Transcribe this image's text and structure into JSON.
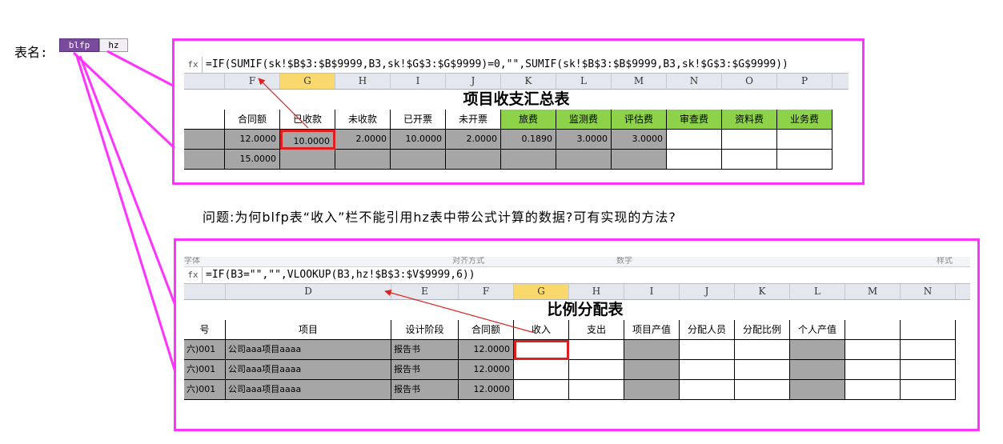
{
  "label_prefix": "表名:",
  "tabs": [
    "blfp",
    "hz"
  ],
  "question": "问题:为何blfp表“收入”栏不能引用hz表中带公式计算的数据?可有实现的方法?",
  "colors": {
    "frame": "#ff33ff",
    "arrow": "#e02020",
    "gray": "#a6a6a6",
    "green": "#8ed24a"
  },
  "top": {
    "formula": "=IF(SUMIF(sk!$B$3:$B$9999,B3,sk!$G$3:$G$9999)=0,\"\",SUMIF(sk!$B$3:$B$9999,B3,sk!$G$3:$G$9999))",
    "columns": [
      "F",
      "G",
      "H",
      "I",
      "J",
      "K",
      "L",
      "M",
      "N",
      "O",
      "P"
    ],
    "selected_column": "G",
    "title": "项目收支汇总表",
    "headers": [
      "合同额",
      "已收款",
      "未收款",
      "已开票",
      "未开票",
      "旅费",
      "监测费",
      "评估费",
      "审查费",
      "资料费",
      "业务费"
    ],
    "row1": [
      "12.0000",
      "10.0000",
      "2.0000",
      "10.0000",
      "2.0000",
      "0.1890",
      "3.0000",
      "3.0000",
      "",
      "",
      ""
    ],
    "row2": [
      "15.0000",
      "",
      "",
      "",
      "",
      "",
      "",
      "",
      "",
      "",
      ""
    ]
  },
  "bottom": {
    "ribbon": [
      "字体",
      "对齐方式",
      "数字",
      "样式"
    ],
    "formula": "=IF(B3=\"\",\"\",VLOOKUP(B3,hz!$B$3:$V$9999,6))",
    "columns": [
      "D",
      "E",
      "F",
      "G",
      "H",
      "I",
      "J",
      "K",
      "L",
      "M",
      "N"
    ],
    "selected_column": "G",
    "title": "比例分配表",
    "headers": [
      "号",
      "项目",
      "设计阶段",
      "合同额",
      "收入",
      "支出",
      "项目产值",
      "分配人员",
      "分配比例",
      "个人产值",
      "",
      ""
    ],
    "rows": [
      [
        "六)001",
        "公司aaa项目aaaa",
        "报告书",
        "12.0000"
      ],
      [
        "六)001",
        "公司aaa项目aaaa",
        "报告书",
        "12.0000"
      ],
      [
        "六)001",
        "公司aaa项目aaaa",
        "报告书",
        "12.0000"
      ]
    ]
  }
}
